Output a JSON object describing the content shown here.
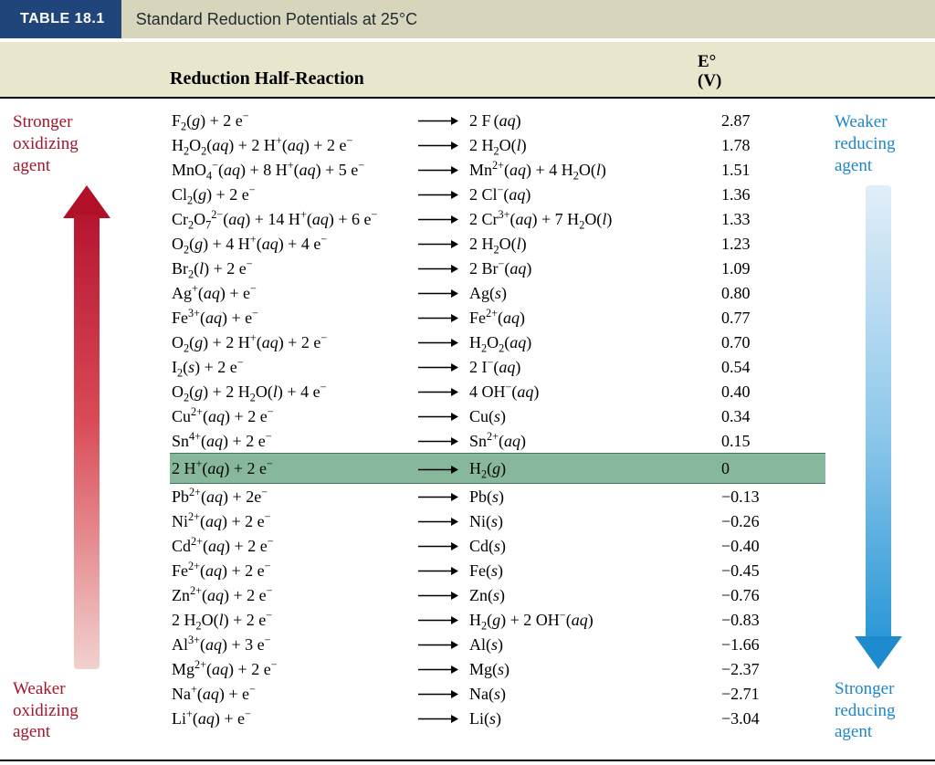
{
  "header": {
    "tab": "TABLE 18.1",
    "title": "Standard Reduction Potentials at 25°C",
    "col_reaction": "Reduction Half-Reaction",
    "col_e_top": "E°",
    "col_e_bottom": "(V)"
  },
  "left_side": {
    "top": "Stronger\noxidizing\nagent",
    "bottom": "Weaker\noxidizing\nagent"
  },
  "right_side": {
    "top": "Weaker\nreducing\nagent",
    "bottom": "Stronger\nreducing\nagent"
  },
  "rows": [
    {
      "lhs": "F<sub>2</sub>(<span class='it'>g</span>)&nbsp;+&nbsp;2&nbsp;e<sup>−</sup>",
      "rhs": "2&nbsp;F<sup>&nbsp;</sup>(<span class='it'>aq</span>)",
      "e": "2.87",
      "hl": false
    },
    {
      "lhs": "H<sub>2</sub>O<sub>2</sub>(<span class='it'>aq</span>)&nbsp;+&nbsp;2&nbsp;H<sup>+</sup>(<span class='it'>aq</span>)&nbsp;+&nbsp;2&nbsp;e<sup>−</sup>",
      "rhs": "2&nbsp;H<sub>2</sub>O(<span class='it'>l</span>)",
      "e": "1.78",
      "hl": false
    },
    {
      "lhs": "MnO<sub>4</sub><sup>−</sup>(<span class='it'>aq</span>)&nbsp;+&nbsp;8&nbsp;H<sup>+</sup>(<span class='it'>aq</span>)&nbsp;+&nbsp;5&nbsp;e<sup>−</sup>",
      "rhs": "Mn<sup>2+</sup>(<span class='it'>aq</span>)&nbsp;+&nbsp;4&nbsp;H<sub>2</sub>O(<span class='it'>l</span>)",
      "e": "1.51",
      "hl": false
    },
    {
      "lhs": "Cl<sub>2</sub>(<span class='it'>g</span>)&nbsp;+&nbsp;2&nbsp;e<sup>−</sup>",
      "rhs": "2&nbsp;Cl<sup>−</sup>(<span class='it'>aq</span>)",
      "e": "1.36",
      "hl": false
    },
    {
      "lhs": "Cr<sub>2</sub>O<sub>7</sub><sup>2−</sup>(<span class='it'>aq</span>)&nbsp;+&nbsp;14&nbsp;H<sup>+</sup>(<span class='it'>aq</span>)&nbsp;+&nbsp;6&nbsp;e<sup>−</sup>",
      "rhs": "2&nbsp;Cr<sup>3+</sup>(<span class='it'>aq</span>)&nbsp;+&nbsp;7&nbsp;H<sub>2</sub>O(<span class='it'>l</span>)",
      "e": "1.33",
      "hl": false
    },
    {
      "lhs": "O<sub>2</sub>(<span class='it'>g</span>)&nbsp;+&nbsp;4&nbsp;H<sup>+</sup>(<span class='it'>aq</span>)&nbsp;+&nbsp;4&nbsp;e<sup>−</sup>",
      "rhs": "2&nbsp;H<sub>2</sub>O(<span class='it'>l</span>)",
      "e": "1.23",
      "hl": false
    },
    {
      "lhs": "Br<sub>2</sub>(<span class='it'>l</span>)&nbsp;+&nbsp;2&nbsp;e<sup>−</sup>",
      "rhs": "2&nbsp;Br<sup>−</sup>(<span class='it'>aq</span>)",
      "e": "1.09",
      "hl": false
    },
    {
      "lhs": "Ag<sup>+</sup>(<span class='it'>aq</span>)&nbsp;+&nbsp;e<sup>−</sup>",
      "rhs": "Ag(<span class='it'>s</span>)",
      "e": "0.80",
      "hl": false
    },
    {
      "lhs": "Fe<sup>3+</sup>(<span class='it'>aq</span>)&nbsp;+&nbsp;e<sup>−</sup>",
      "rhs": "Fe<sup>2+</sup>(<span class='it'>aq</span>)",
      "e": "0.77",
      "hl": false
    },
    {
      "lhs": "O<sub>2</sub>(<span class='it'>g</span>)&nbsp;+&nbsp;2&nbsp;H<sup>+</sup>(<span class='it'>aq</span>)&nbsp;+&nbsp;2&nbsp;e<sup>−</sup>",
      "rhs": "H<sub>2</sub>O<sub>2</sub>(<span class='it'>aq</span>)",
      "e": "0.70",
      "hl": false
    },
    {
      "lhs": "I<sub>2</sub>(<span class='it'>s</span>)&nbsp;+&nbsp;2&nbsp;e<sup>−</sup>",
      "rhs": "2&nbsp;I<sup>−</sup>(<span class='it'>aq</span>)",
      "e": "0.54",
      "hl": false
    },
    {
      "lhs": "O<sub>2</sub>(<span class='it'>g</span>)&nbsp;+&nbsp;2&nbsp;H<sub>2</sub>O(<span class='it'>l</span>)&nbsp;+&nbsp;4&nbsp;e<sup>−</sup>",
      "rhs": "4&nbsp;OH<sup>−</sup>(<span class='it'>aq</span>)",
      "e": "0.40",
      "hl": false
    },
    {
      "lhs": "Cu<sup>2+</sup>(<span class='it'>aq</span>)&nbsp;+&nbsp;2&nbsp;e<sup>−</sup>",
      "rhs": "Cu(<span class='it'>s</span>)",
      "e": "0.34",
      "hl": false
    },
    {
      "lhs": "Sn<sup>4+</sup>(<span class='it'>aq</span>)&nbsp;+&nbsp;2&nbsp;e<sup>−</sup>",
      "rhs": "Sn<sup>2+</sup>(<span class='it'>aq</span>)",
      "e": "0.15",
      "hl": false
    },
    {
      "lhs": "2&nbsp;H<sup>+</sup>(<span class='it'>aq</span>)&nbsp;+&nbsp;2&nbsp;e<sup>−</sup>",
      "rhs": "H<sub>2</sub>(<span class='it'>g</span>)",
      "e": "0",
      "hl": true
    },
    {
      "lhs": "Pb<sup>2+</sup>(<span class='it'>aq</span>)&nbsp;+&nbsp;2e<sup>−</sup>",
      "rhs": "Pb(<span class='it'>s</span>)",
      "e": "−0.13",
      "hl": false
    },
    {
      "lhs": "Ni<sup>2+</sup>(<span class='it'>aq</span>)&nbsp;+&nbsp;2&nbsp;e<sup>−</sup>",
      "rhs": "Ni(<span class='it'>s</span>)",
      "e": "−0.26",
      "hl": false
    },
    {
      "lhs": "Cd<sup>2+</sup>(<span class='it'>aq</span>)&nbsp;+&nbsp;2&nbsp;e<sup>−</sup>",
      "rhs": "Cd(<span class='it'>s</span>)",
      "e": "−0.40",
      "hl": false
    },
    {
      "lhs": "Fe<sup>2+</sup>(<span class='it'>aq</span>)&nbsp;+&nbsp;2&nbsp;e<sup>−</sup>",
      "rhs": "Fe(<span class='it'>s</span>)",
      "e": "−0.45",
      "hl": false
    },
    {
      "lhs": "Zn<sup>2+</sup>(<span class='it'>aq</span>)&nbsp;+&nbsp;2&nbsp;e<sup>−</sup>",
      "rhs": "Zn(<span class='it'>s</span>)",
      "e": "−0.76",
      "hl": false
    },
    {
      "lhs": "2&nbsp;H<sub>2</sub>O(<span class='it'>l</span>)&nbsp;+&nbsp;2&nbsp;e<sup>−</sup>",
      "rhs": "H<sub>2</sub>(<span class='it'>g</span>)&nbsp;+&nbsp;2&nbsp;OH<sup>−</sup>(<span class='it'>aq</span>)",
      "e": "−0.83",
      "hl": false
    },
    {
      "lhs": "Al<sup>3+</sup>(<span class='it'>aq</span>)&nbsp;+&nbsp;3&nbsp;e<sup>−</sup>",
      "rhs": "Al(<span class='it'>s</span>)",
      "e": "−1.66",
      "hl": false
    },
    {
      "lhs": "Mg<sup>2+</sup>(<span class='it'>aq</span>)&nbsp;+&nbsp;2&nbsp;e<sup>−</sup>",
      "rhs": "Mg(<span class='it'>s</span>)",
      "e": "−2.37",
      "hl": false
    },
    {
      "lhs": "Na<sup>+</sup>(<span class='it'>aq</span>)&nbsp;+&nbsp;e<sup>−</sup>",
      "rhs": "Na(<span class='it'>s</span>)",
      "e": "−2.71",
      "hl": false
    },
    {
      "lhs": "Li<sup>+</sup>(<span class='it'>aq</span>)&nbsp;+&nbsp;e<sup>−</sup>",
      "rhs": "Li(<span class='it'>s</span>)",
      "e": "−3.04",
      "hl": false
    }
  ]
}
